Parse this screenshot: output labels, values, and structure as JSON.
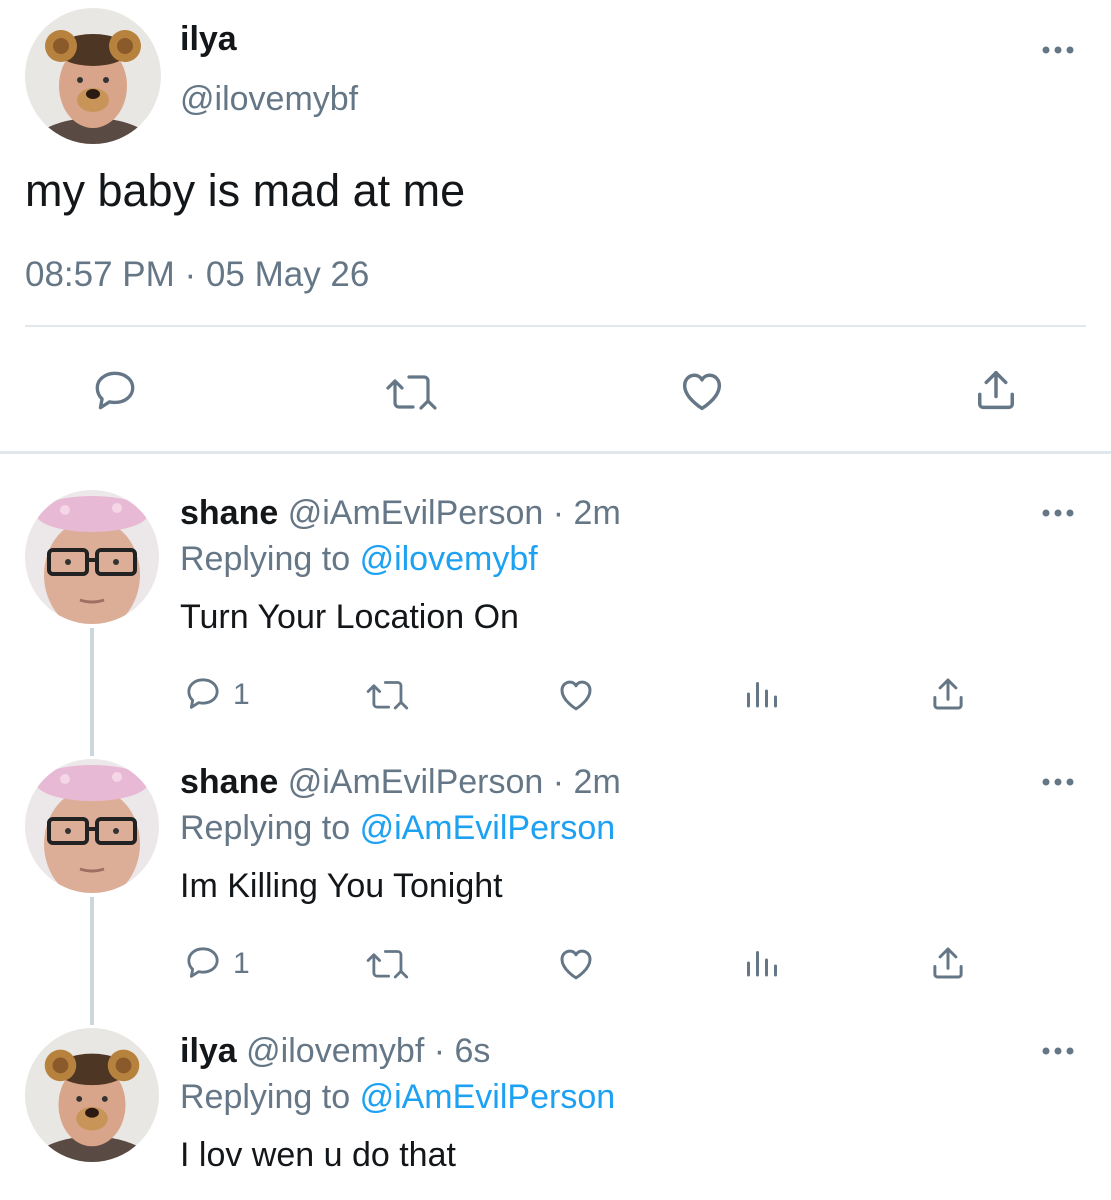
{
  "main_tweet": {
    "name": "ilya",
    "handle": "@ilovemybf",
    "text": "my baby is mad at me",
    "timestamp": "08:57 PM · 05 May 26"
  },
  "replies": [
    {
      "name": "shane",
      "handle": "@iAmEvilPerson",
      "time": "· 2m",
      "replying_prefix": "Replying to",
      "replying_to": "@ilovemybf",
      "text": "Turn Your Location On",
      "reply_count": "1"
    },
    {
      "name": "shane",
      "handle": "@iAmEvilPerson",
      "time": "· 2m",
      "replying_prefix": "Replying to",
      "replying_to": "@iAmEvilPerson",
      "text": "Im Killing You Tonight",
      "reply_count": "1"
    },
    {
      "name": "ilya",
      "handle": "@ilovemybf",
      "time": "· 6s",
      "replying_prefix": "Replying to",
      "replying_to": "@iAmEvilPerson",
      "text": "I lov wen u do that"
    }
  ],
  "colors": {
    "text": "#14171a",
    "muted": "#657786",
    "link": "#1da1f2",
    "divider": "#e1e8ed",
    "thread_line": "#ccd6dd"
  },
  "icons": [
    "reply-icon",
    "retweet-icon",
    "like-icon",
    "share-icon",
    "analytics-icon",
    "more-icon"
  ]
}
